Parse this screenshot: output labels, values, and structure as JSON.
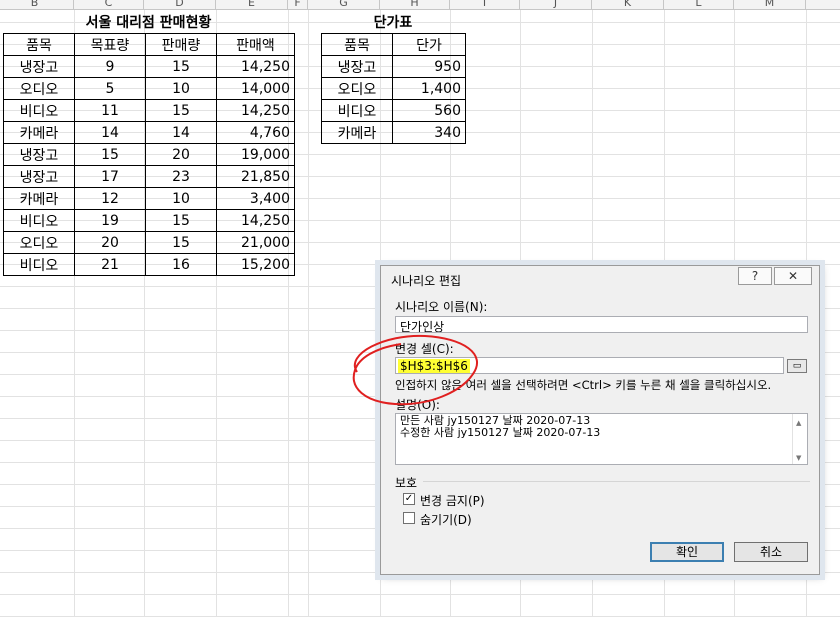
{
  "columns": [
    "B",
    "C",
    "D",
    "E",
    "F",
    "G",
    "H",
    "I",
    "J",
    "K",
    "L",
    "M"
  ],
  "sales": {
    "title": "서울 대리점 판매현황",
    "headers": [
      "품목",
      "목표량",
      "판매량",
      "판매액"
    ],
    "rows": [
      [
        "냉장고",
        "9",
        "15",
        "14,250"
      ],
      [
        "오디오",
        "5",
        "10",
        "14,000"
      ],
      [
        "비디오",
        "11",
        "15",
        "14,250"
      ],
      [
        "카메라",
        "14",
        "14",
        "4,760"
      ],
      [
        "냉장고",
        "15",
        "20",
        "19,000"
      ],
      [
        "냉장고",
        "17",
        "23",
        "21,850"
      ],
      [
        "카메라",
        "12",
        "10",
        "3,400"
      ],
      [
        "비디오",
        "19",
        "15",
        "14,250"
      ],
      [
        "오디오",
        "20",
        "15",
        "21,000"
      ],
      [
        "비디오",
        "21",
        "16",
        "15,200"
      ]
    ]
  },
  "price": {
    "title": "단가표",
    "headers": [
      "품목",
      "단가"
    ],
    "rows": [
      [
        "냉장고",
        "950"
      ],
      [
        "오디오",
        "1,400"
      ],
      [
        "비디오",
        "560"
      ],
      [
        "카메라",
        "340"
      ]
    ]
  },
  "dialog": {
    "title": "시나리오 편집",
    "help": "?",
    "close": "✕",
    "name_label": "시나리오 이름(N):",
    "name_value": "단가인상",
    "changing_label": "변경 셀(C):",
    "changing_value": "$H$3:$H$6",
    "hint": "인접하지 않은 여러 셀을 선택하려면 <Ctrl> 키를 누른 채 셀을 클릭하십시오.",
    "comment_label": "설명(O):",
    "comment_lines": [
      "만든 사람 jy150127 날짜 2020-07-13",
      "수정한 사람 jy150127 날짜 2020-07-13"
    ],
    "protection_label": "보호",
    "prevent_changes": "변경 금지(P)",
    "hide": "숨기기(D)",
    "ok": "확인",
    "cancel": "취소",
    "annotation_color": "#e02020",
    "highlight_color": "#ffff33"
  }
}
